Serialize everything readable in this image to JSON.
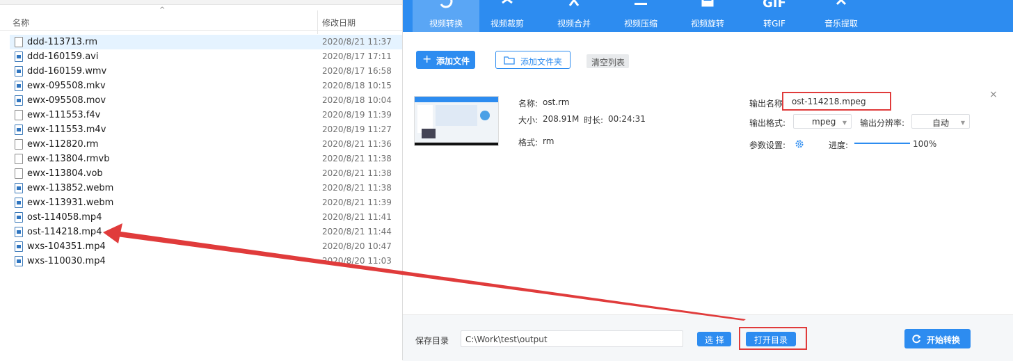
{
  "explorer": {
    "header": {
      "name_col": "名称",
      "date_col": "修改日期",
      "sort_indicator": "^"
    },
    "files": [
      {
        "name": "ddd-113713.rm",
        "date": "2020/8/21 11:37",
        "icon": "plain-file-icon"
      },
      {
        "name": "ddd-160159.avi",
        "date": "2020/8/17 17:11",
        "icon": "video-file-icon"
      },
      {
        "name": "ddd-160159.wmv",
        "date": "2020/8/17 16:58",
        "icon": "video-file-icon"
      },
      {
        "name": "ewx-095508.mkv",
        "date": "2020/8/18 10:15",
        "icon": "video-file-icon"
      },
      {
        "name": "ewx-095508.mov",
        "date": "2020/8/18 10:04",
        "icon": "video-file-icon"
      },
      {
        "name": "ewx-111553.f4v",
        "date": "2020/8/19 11:39",
        "icon": "plain-file-icon"
      },
      {
        "name": "ewx-111553.m4v",
        "date": "2020/8/19 11:27",
        "icon": "video-file-icon"
      },
      {
        "name": "ewx-112820.rm",
        "date": "2020/8/21 11:36",
        "icon": "plain-file-icon"
      },
      {
        "name": "ewx-113804.rmvb",
        "date": "2020/8/21 11:38",
        "icon": "plain-file-icon"
      },
      {
        "name": "ewx-113804.vob",
        "date": "2020/8/21 11:38",
        "icon": "plain-file-icon"
      },
      {
        "name": "ewx-113852.webm",
        "date": "2020/8/21 11:38",
        "icon": "video-file-icon"
      },
      {
        "name": "ewx-113931.webm",
        "date": "2020/8/21 11:39",
        "icon": "video-file-icon"
      },
      {
        "name": "ost-114058.mp4",
        "date": "2020/8/21 11:41",
        "icon": "video-file-icon"
      },
      {
        "name": "ost-114218.mp4",
        "date": "2020/8/21 11:44",
        "icon": "video-file-icon"
      },
      {
        "name": "wxs-104351.mp4",
        "date": "2020/8/20 10:47",
        "icon": "video-file-icon"
      },
      {
        "name": "wxs-110030.mp4",
        "date": "2020/8/20 11:03",
        "icon": "video-file-icon"
      }
    ]
  },
  "app": {
    "tabs": [
      {
        "label": "视频转换",
        "icon": "convert-icon"
      },
      {
        "label": "视频裁剪",
        "icon": "scissors-icon"
      },
      {
        "label": "视频合并",
        "icon": "merge-icon"
      },
      {
        "label": "视频压缩",
        "icon": "compress-icon"
      },
      {
        "label": "视频旋转",
        "icon": "rotate-icon"
      },
      {
        "label": "转GIF",
        "icon": "gif-icon",
        "icon_text": "GIF"
      },
      {
        "label": "音乐提取",
        "icon": "music-extract-icon"
      }
    ],
    "toolbar": {
      "add_file": "添加文件",
      "add_folder": "添加文件夹",
      "clear_list": "清空列表"
    },
    "item": {
      "name_label": "名称:",
      "name_value": "ost.rm",
      "size_label": "大小:",
      "size_value": "208.91M",
      "duration_label": "时长:",
      "duration_value": "00:24:31",
      "format_label": "格式:",
      "format_value": "rm",
      "output_name_label": "输出名称",
      "output_name_value": "ost-114218.mpeg",
      "output_format_label": "输出格式:",
      "output_format_value": "mpeg",
      "output_resolution_label": "输出分辨率:",
      "output_resolution_value": "自动",
      "params_label": "参数设置:",
      "progress_label": "进度:",
      "progress_text": "100%",
      "progress_value": 1.0,
      "close_symbol": "×"
    },
    "bottom": {
      "save_dir_label": "保存目录",
      "save_dir_value": "C:\\Work\\test\\output",
      "select_button": "选 择",
      "open_dir_button": "打开目录",
      "start_button": "开始转换"
    },
    "colors": {
      "accent": "#2d8cf0",
      "annotation": "#e03b3b"
    }
  }
}
